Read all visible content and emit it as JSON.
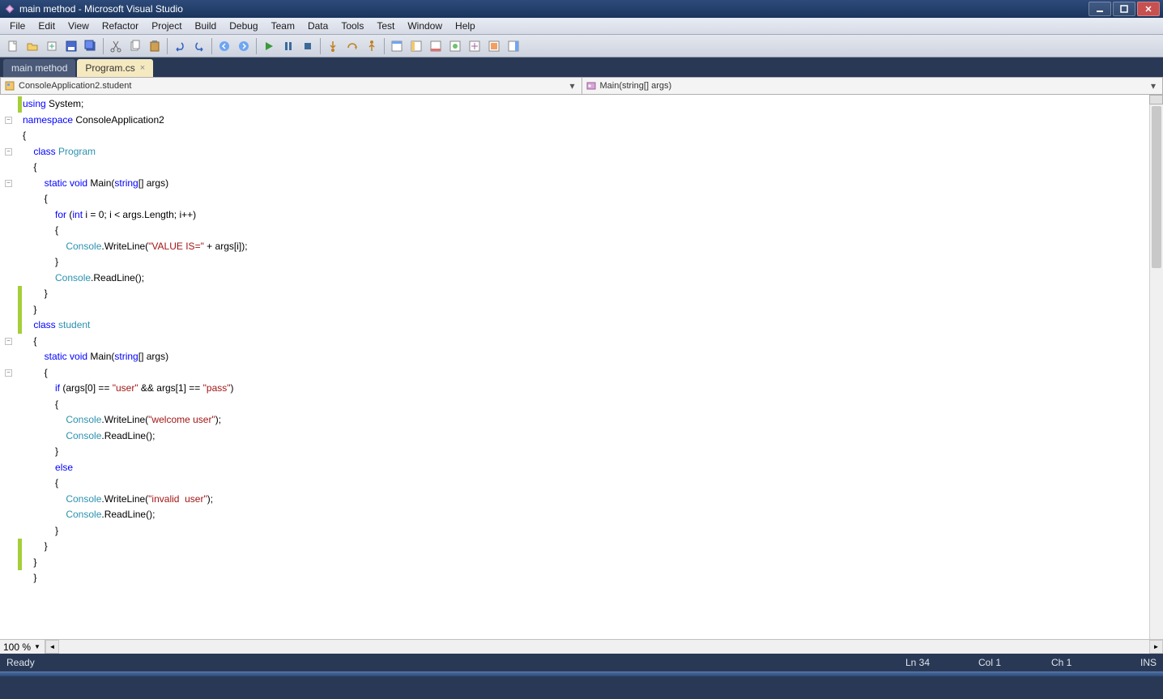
{
  "titlebar": {
    "title": "main method - Microsoft Visual Studio"
  },
  "menu": [
    "File",
    "Edit",
    "View",
    "Refactor",
    "Project",
    "Build",
    "Debug",
    "Team",
    "Data",
    "Tools",
    "Test",
    "Window",
    "Help"
  ],
  "tabs": [
    {
      "label": "main method",
      "active": false,
      "closable": false
    },
    {
      "label": "Program.cs",
      "active": true,
      "closable": true
    }
  ],
  "nav": {
    "left": "ConsoleApplication2.student",
    "right": "Main(string[] args)"
  },
  "code_lines": [
    {
      "i": 0,
      "t": [
        {
          "c": "kw",
          "s": "using"
        },
        {
          "c": "",
          "s": " System;"
        }
      ]
    },
    {
      "i": 0,
      "t": [
        {
          "c": "kw",
          "s": "namespace"
        },
        {
          "c": "",
          "s": " ConsoleApplication2"
        }
      ]
    },
    {
      "i": 0,
      "t": [
        {
          "c": "",
          "s": "{"
        }
      ]
    },
    {
      "i": 1,
      "t": [
        {
          "c": "kw",
          "s": "class"
        },
        {
          "c": "",
          "s": " "
        },
        {
          "c": "type",
          "s": "Program"
        }
      ]
    },
    {
      "i": 1,
      "t": [
        {
          "c": "",
          "s": "{"
        }
      ]
    },
    {
      "i": 2,
      "t": [
        {
          "c": "kw",
          "s": "static"
        },
        {
          "c": "",
          "s": " "
        },
        {
          "c": "kw",
          "s": "void"
        },
        {
          "c": "",
          "s": " Main("
        },
        {
          "c": "kw",
          "s": "string"
        },
        {
          "c": "",
          "s": "[] args)"
        }
      ]
    },
    {
      "i": 2,
      "t": [
        {
          "c": "",
          "s": "{"
        }
      ]
    },
    {
      "i": 3,
      "t": [
        {
          "c": "kw",
          "s": "for"
        },
        {
          "c": "",
          "s": " ("
        },
        {
          "c": "kw",
          "s": "int"
        },
        {
          "c": "",
          "s": " i = 0; i < args.Length; i++)"
        }
      ]
    },
    {
      "i": 3,
      "t": [
        {
          "c": "",
          "s": "{"
        }
      ]
    },
    {
      "i": 4,
      "t": [
        {
          "c": "type",
          "s": "Console"
        },
        {
          "c": "",
          "s": ".WriteLine("
        },
        {
          "c": "str",
          "s": "\"VALUE IS=\""
        },
        {
          "c": "",
          "s": " + args[i]);"
        }
      ]
    },
    {
      "i": 0,
      "t": [
        {
          "c": "",
          "s": ""
        }
      ]
    },
    {
      "i": 3,
      "t": [
        {
          "c": "",
          "s": "}"
        }
      ]
    },
    {
      "i": 3,
      "t": [
        {
          "c": "type",
          "s": "Console"
        },
        {
          "c": "",
          "s": ".ReadLine();"
        }
      ]
    },
    {
      "i": 2,
      "t": [
        {
          "c": "",
          "s": "}"
        }
      ]
    },
    {
      "i": 1,
      "t": [
        {
          "c": "",
          "s": "}"
        }
      ]
    },
    {
      "i": 1,
      "t": [
        {
          "c": "kw",
          "s": "class"
        },
        {
          "c": "",
          "s": " "
        },
        {
          "c": "type",
          "s": "student"
        }
      ]
    },
    {
      "i": 1,
      "t": [
        {
          "c": "",
          "s": "{"
        }
      ]
    },
    {
      "i": 2,
      "t": [
        {
          "c": "kw",
          "s": "static"
        },
        {
          "c": "",
          "s": " "
        },
        {
          "c": "kw",
          "s": "void"
        },
        {
          "c": "",
          "s": " Main("
        },
        {
          "c": "kw",
          "s": "string"
        },
        {
          "c": "",
          "s": "[] args)"
        }
      ]
    },
    {
      "i": 2,
      "t": [
        {
          "c": "",
          "s": "{"
        }
      ]
    },
    {
      "i": 3,
      "t": [
        {
          "c": "kw",
          "s": "if"
        },
        {
          "c": "",
          "s": " (args[0] == "
        },
        {
          "c": "str",
          "s": "\"user\""
        },
        {
          "c": "",
          "s": " && args[1] == "
        },
        {
          "c": "str",
          "s": "\"pass\""
        },
        {
          "c": "",
          "s": ")"
        }
      ]
    },
    {
      "i": 3,
      "t": [
        {
          "c": "",
          "s": "{"
        }
      ]
    },
    {
      "i": 4,
      "t": [
        {
          "c": "type",
          "s": "Console"
        },
        {
          "c": "",
          "s": ".WriteLine("
        },
        {
          "c": "str",
          "s": "\"welcome user\""
        },
        {
          "c": "",
          "s": ");"
        }
      ]
    },
    {
      "i": 4,
      "t": [
        {
          "c": "type",
          "s": "Console"
        },
        {
          "c": "",
          "s": ".ReadLine();"
        }
      ]
    },
    {
      "i": 3,
      "t": [
        {
          "c": "",
          "s": "}"
        }
      ]
    },
    {
      "i": 3,
      "t": [
        {
          "c": "kw",
          "s": "else"
        }
      ]
    },
    {
      "i": 3,
      "t": [
        {
          "c": "",
          "s": "{"
        }
      ]
    },
    {
      "i": 4,
      "t": [
        {
          "c": "type",
          "s": "Console"
        },
        {
          "c": "",
          "s": ".WriteLine("
        },
        {
          "c": "str",
          "s": "\"invalid  user\""
        },
        {
          "c": "",
          "s": ");"
        }
      ]
    },
    {
      "i": 4,
      "t": [
        {
          "c": "type",
          "s": "Console"
        },
        {
          "c": "",
          "s": ".ReadLine();"
        }
      ]
    },
    {
      "i": 3,
      "t": [
        {
          "c": "",
          "s": "}"
        }
      ]
    },
    {
      "i": 2,
      "t": [
        {
          "c": "",
          "s": "}"
        }
      ]
    },
    {
      "i": 0,
      "t": [
        {
          "c": "",
          "s": ""
        }
      ]
    },
    {
      "i": 1,
      "t": [
        {
          "c": "",
          "s": "}"
        }
      ]
    },
    {
      "i": 1,
      "t": [
        {
          "c": "",
          "s": "}"
        }
      ]
    }
  ],
  "outline_boxes": [
    1,
    3,
    5,
    15,
    17
  ],
  "mod_marks": [
    {
      "from": 0,
      "to": 0
    },
    {
      "from": 12,
      "to": 14
    },
    {
      "from": 28,
      "to": 29
    }
  ],
  "zoom": "100 %",
  "status": {
    "ready": "Ready",
    "ln": "Ln 34",
    "col": "Col 1",
    "ch": "Ch 1",
    "ins": "INS"
  },
  "toolbar_icons": [
    "new",
    "open",
    "add",
    "save",
    "saveall",
    "sep",
    "cut",
    "copy",
    "paste",
    "sep",
    "undo",
    "redo",
    "sep",
    "nav-back",
    "nav-fwd",
    "sep",
    "play",
    "pause",
    "stop",
    "sep",
    "step-into",
    "step-over",
    "step-out",
    "sep",
    "win1",
    "win2",
    "win3",
    "win4",
    "win5",
    "win6",
    "win7"
  ]
}
